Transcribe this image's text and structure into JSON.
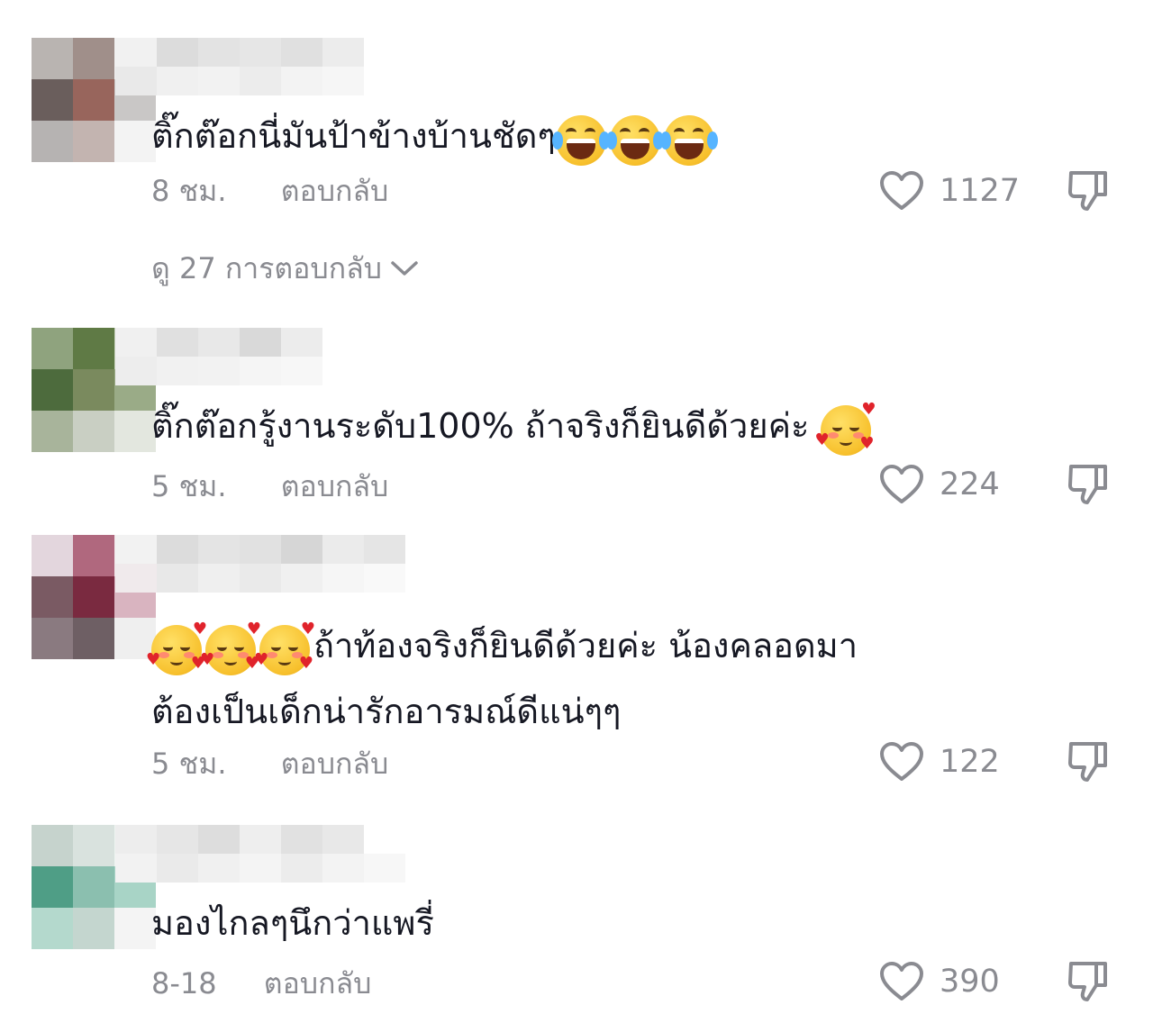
{
  "comments": [
    {
      "text": "ติ๊กต๊อกนี่มันป้าข้างบ้านชัดๆ",
      "emoji": [
        "face-with-tears-of-joy",
        "face-with-tears-of-joy",
        "face-with-tears-of-joy"
      ],
      "time": "8 ชม.",
      "reply_label": "ตอบกลับ",
      "likes": "1127",
      "view_replies": {
        "prefix": "ดู",
        "count": "27",
        "suffix": "การตอบกลับ"
      }
    },
    {
      "text": "ติ๊กต๊อกรู้งานระดับ100% ถ้าจริงก็ยินดีด้วยค่ะ",
      "emoji": [
        "smiling-face-with-hearts"
      ],
      "time": "5 ชม.",
      "reply_label": "ตอบกลับ",
      "likes": "224"
    },
    {
      "emoji": [
        "smiling-face-with-hearts",
        "smiling-face-with-hearts",
        "smiling-face-with-hearts"
      ],
      "text_line1": "ถ้าท้องจริงก็ยินดีด้วยค่ะ น้องคลอดมา",
      "text_line2": "ต้องเป็นเด็กน่ารักอารมณ์ดีแน่ๆๆ",
      "time": "5 ชม.",
      "reply_label": "ตอบกลับ",
      "likes": "122"
    },
    {
      "text": "มองไกลๆนึกว่าแพรี่",
      "time": "8-18",
      "reply_label": "ตอบกลับ",
      "likes": "390"
    }
  ],
  "colors": {
    "text": "#161823",
    "secondary": "#8a8b91",
    "background": "#ffffff"
  },
  "icons": {
    "like": "heart-outline-icon",
    "dislike": "thumbs-down-icon",
    "expand": "chevron-down-icon"
  }
}
